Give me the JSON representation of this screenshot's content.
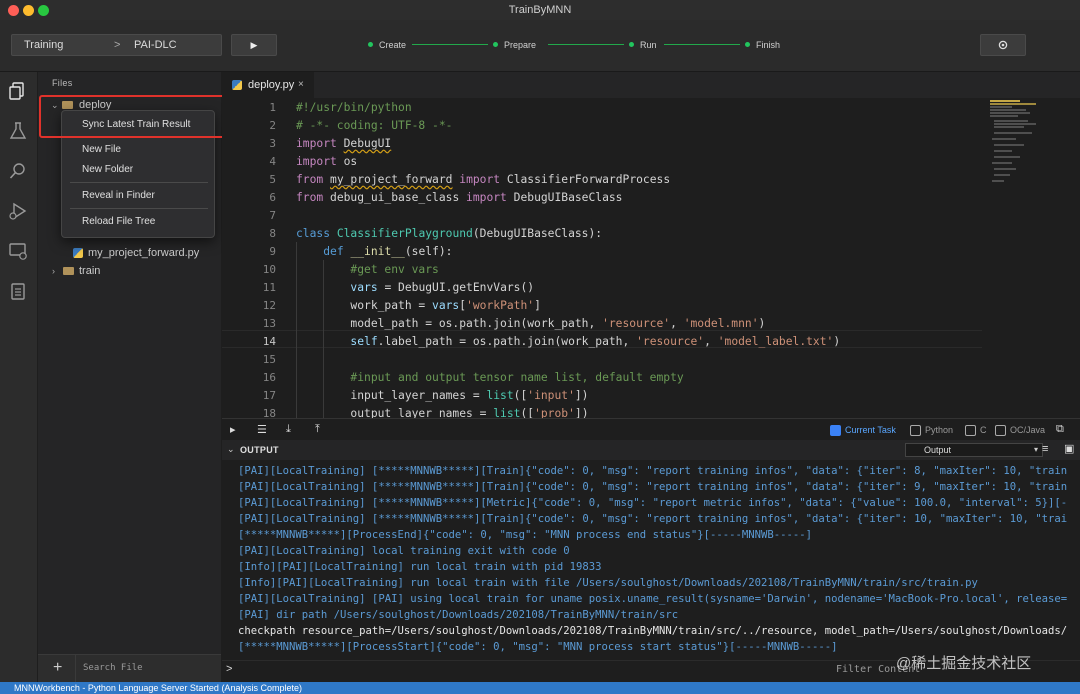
{
  "window": {
    "title": "TrainByMNN"
  },
  "toolbar": {
    "breadcrumb": [
      "Training",
      "PAI-DLC"
    ],
    "breadcrumb_sep": ">",
    "run_icon": "play-icon",
    "steps": [
      "Create",
      "Prepare",
      "Run",
      "Finish"
    ],
    "settings_icon": "gear-icon"
  },
  "sidebar": {
    "header": "Files",
    "tree": [
      {
        "label": "deploy",
        "type": "folder",
        "expanded": true
      },
      {
        "label": "my_project_forward.py",
        "type": "python"
      },
      {
        "label": "train",
        "type": "folder",
        "expanded": false
      }
    ],
    "context_menu": [
      "Sync Latest Train Result",
      "New File",
      "New Folder",
      "Reveal in Finder",
      "Reload File Tree"
    ],
    "search_placeholder": "Search File",
    "add_label": "+"
  },
  "editor": {
    "tab": {
      "name": "deploy.py",
      "close": "×"
    },
    "line_numbers": [
      "1",
      "2",
      "3",
      "4",
      "5",
      "6",
      "7",
      "8",
      "9",
      "10",
      "11",
      "12",
      "13",
      "14",
      "15",
      "16",
      "17",
      "18"
    ],
    "code": [
      "#!/usr/bin/python",
      "# -*- coding: UTF-8 -*-",
      "import DebugUI",
      "import os",
      "from my_project_forward import ClassifierForwardProcess",
      "from debug_ui_base_class import DebugUIBaseClass",
      "",
      "class ClassifierPlayground(DebugUIBaseClass):",
      "    def __init__(self):",
      "        #get env vars",
      "        vars = DebugUI.getEnvVars()",
      "        work_path = vars['workPath']",
      "        model_path = os.path.join(work_path, 'resource', 'model.mnn')",
      "        self.label_path = os.path.join(work_path, 'resource', 'model_label.txt')",
      "",
      "        #input and output tensor name list, default empty",
      "        input_layer_names = list(['input'])",
      "        output_layer_names = list(['prob'])"
    ]
  },
  "panel": {
    "filters": [
      {
        "label": "Current Task",
        "checked": true
      },
      {
        "label": "Python",
        "checked": false
      },
      {
        "label": "C",
        "checked": false
      },
      {
        "label": "OC/Java",
        "checked": false
      }
    ],
    "output_title": "OUTPUT",
    "output_channel": "Output",
    "lines": [
      "[PAI][LocalTraining] [*****MNNWB*****][Train]{\"code\": 0, \"msg\": \"report training infos\", \"data\": {\"iter\": 8, \"maxIter\": 10, \"train",
      "[PAI][LocalTraining] [*****MNNWB*****][Train]{\"code\": 0, \"msg\": \"report training infos\", \"data\": {\"iter\": 9, \"maxIter\": 10, \"train",
      "[PAI][LocalTraining] [*****MNNWB*****][Metric]{\"code\": 0, \"msg\": \"report metric infos\", \"data\": {\"value\": 100.0, \"interval\": 5}][-",
      "[PAI][LocalTraining] [*****MNNWB*****][Train]{\"code\": 0, \"msg\": \"report training infos\", \"data\": {\"iter\": 10, \"maxIter\": 10, \"trai",
      "[*****MNNWB*****][ProcessEnd]{\"code\": 0, \"msg\": \"MNN process end status\"}[-----MNNWB-----]",
      "[PAI][LocalTraining] local training exit with code 0",
      "[Info][PAI][LocalTraining] run local train with pid 19833",
      "[Info][PAI][LocalTraining] run local train with file /Users/soulghost/Downloads/202108/TrainByMNN/train/src/train.py",
      "[PAI][LocalTraining] [PAI] using local train for uname posix.uname_result(sysname='Darwin', nodename='MacBook-Pro.local', release=",
      "[PAI] dir path /Users/soulghost/Downloads/202108/TrainByMNN/train/src",
      "checkpath resource_path=/Users/soulghost/Downloads/202108/TrainByMNN/train/src/../resource, model_path=/Users/soulghost/Downloads/",
      "[*****MNNWB*****][ProcessStart]{\"code\": 0, \"msg\": \"MNN process start status\"}[-----MNNWB-----]"
    ],
    "prompt": ">",
    "filter_placeholder": "Filter Content"
  },
  "watermark": "@稀土掘金技术社区",
  "status": "MNNWorkbench - Python Language Server Started (Analysis Complete)"
}
